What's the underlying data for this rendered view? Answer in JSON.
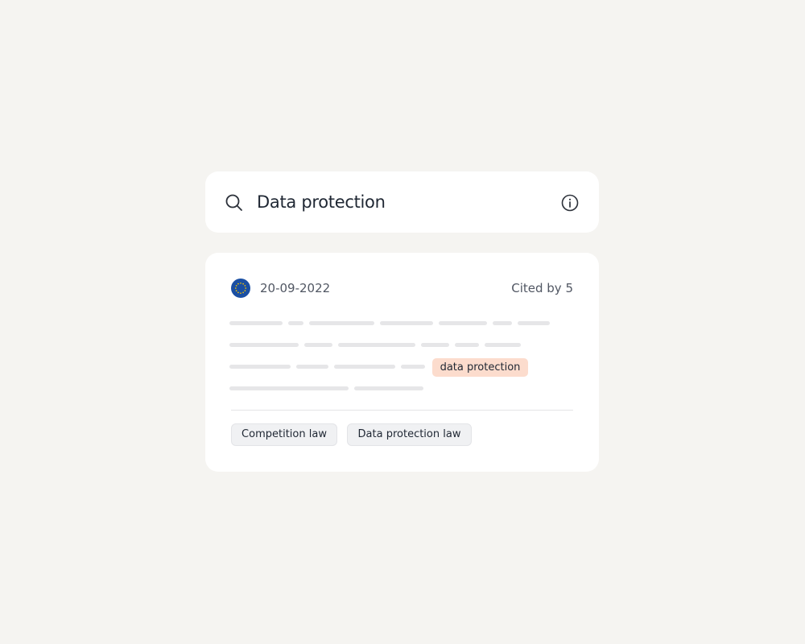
{
  "search": {
    "value": "Data protection",
    "icon": "search-icon",
    "info_icon": "info-icon"
  },
  "result": {
    "jurisdiction_icon": "eu-flag-icon",
    "date": "20-09-2022",
    "cited_by": "Cited by 5",
    "highlight": "data protection",
    "tags": [
      "Competition law",
      "Data protection law"
    ]
  },
  "colors": {
    "background": "#f5f4f1",
    "card": "#ffffff",
    "eu_blue": "#1a4fa3",
    "eu_star": "#f2c200",
    "highlight_bg": "#fcdccd",
    "tag_bg": "#f0f1f3",
    "skeleton": "#e6e6e8"
  }
}
